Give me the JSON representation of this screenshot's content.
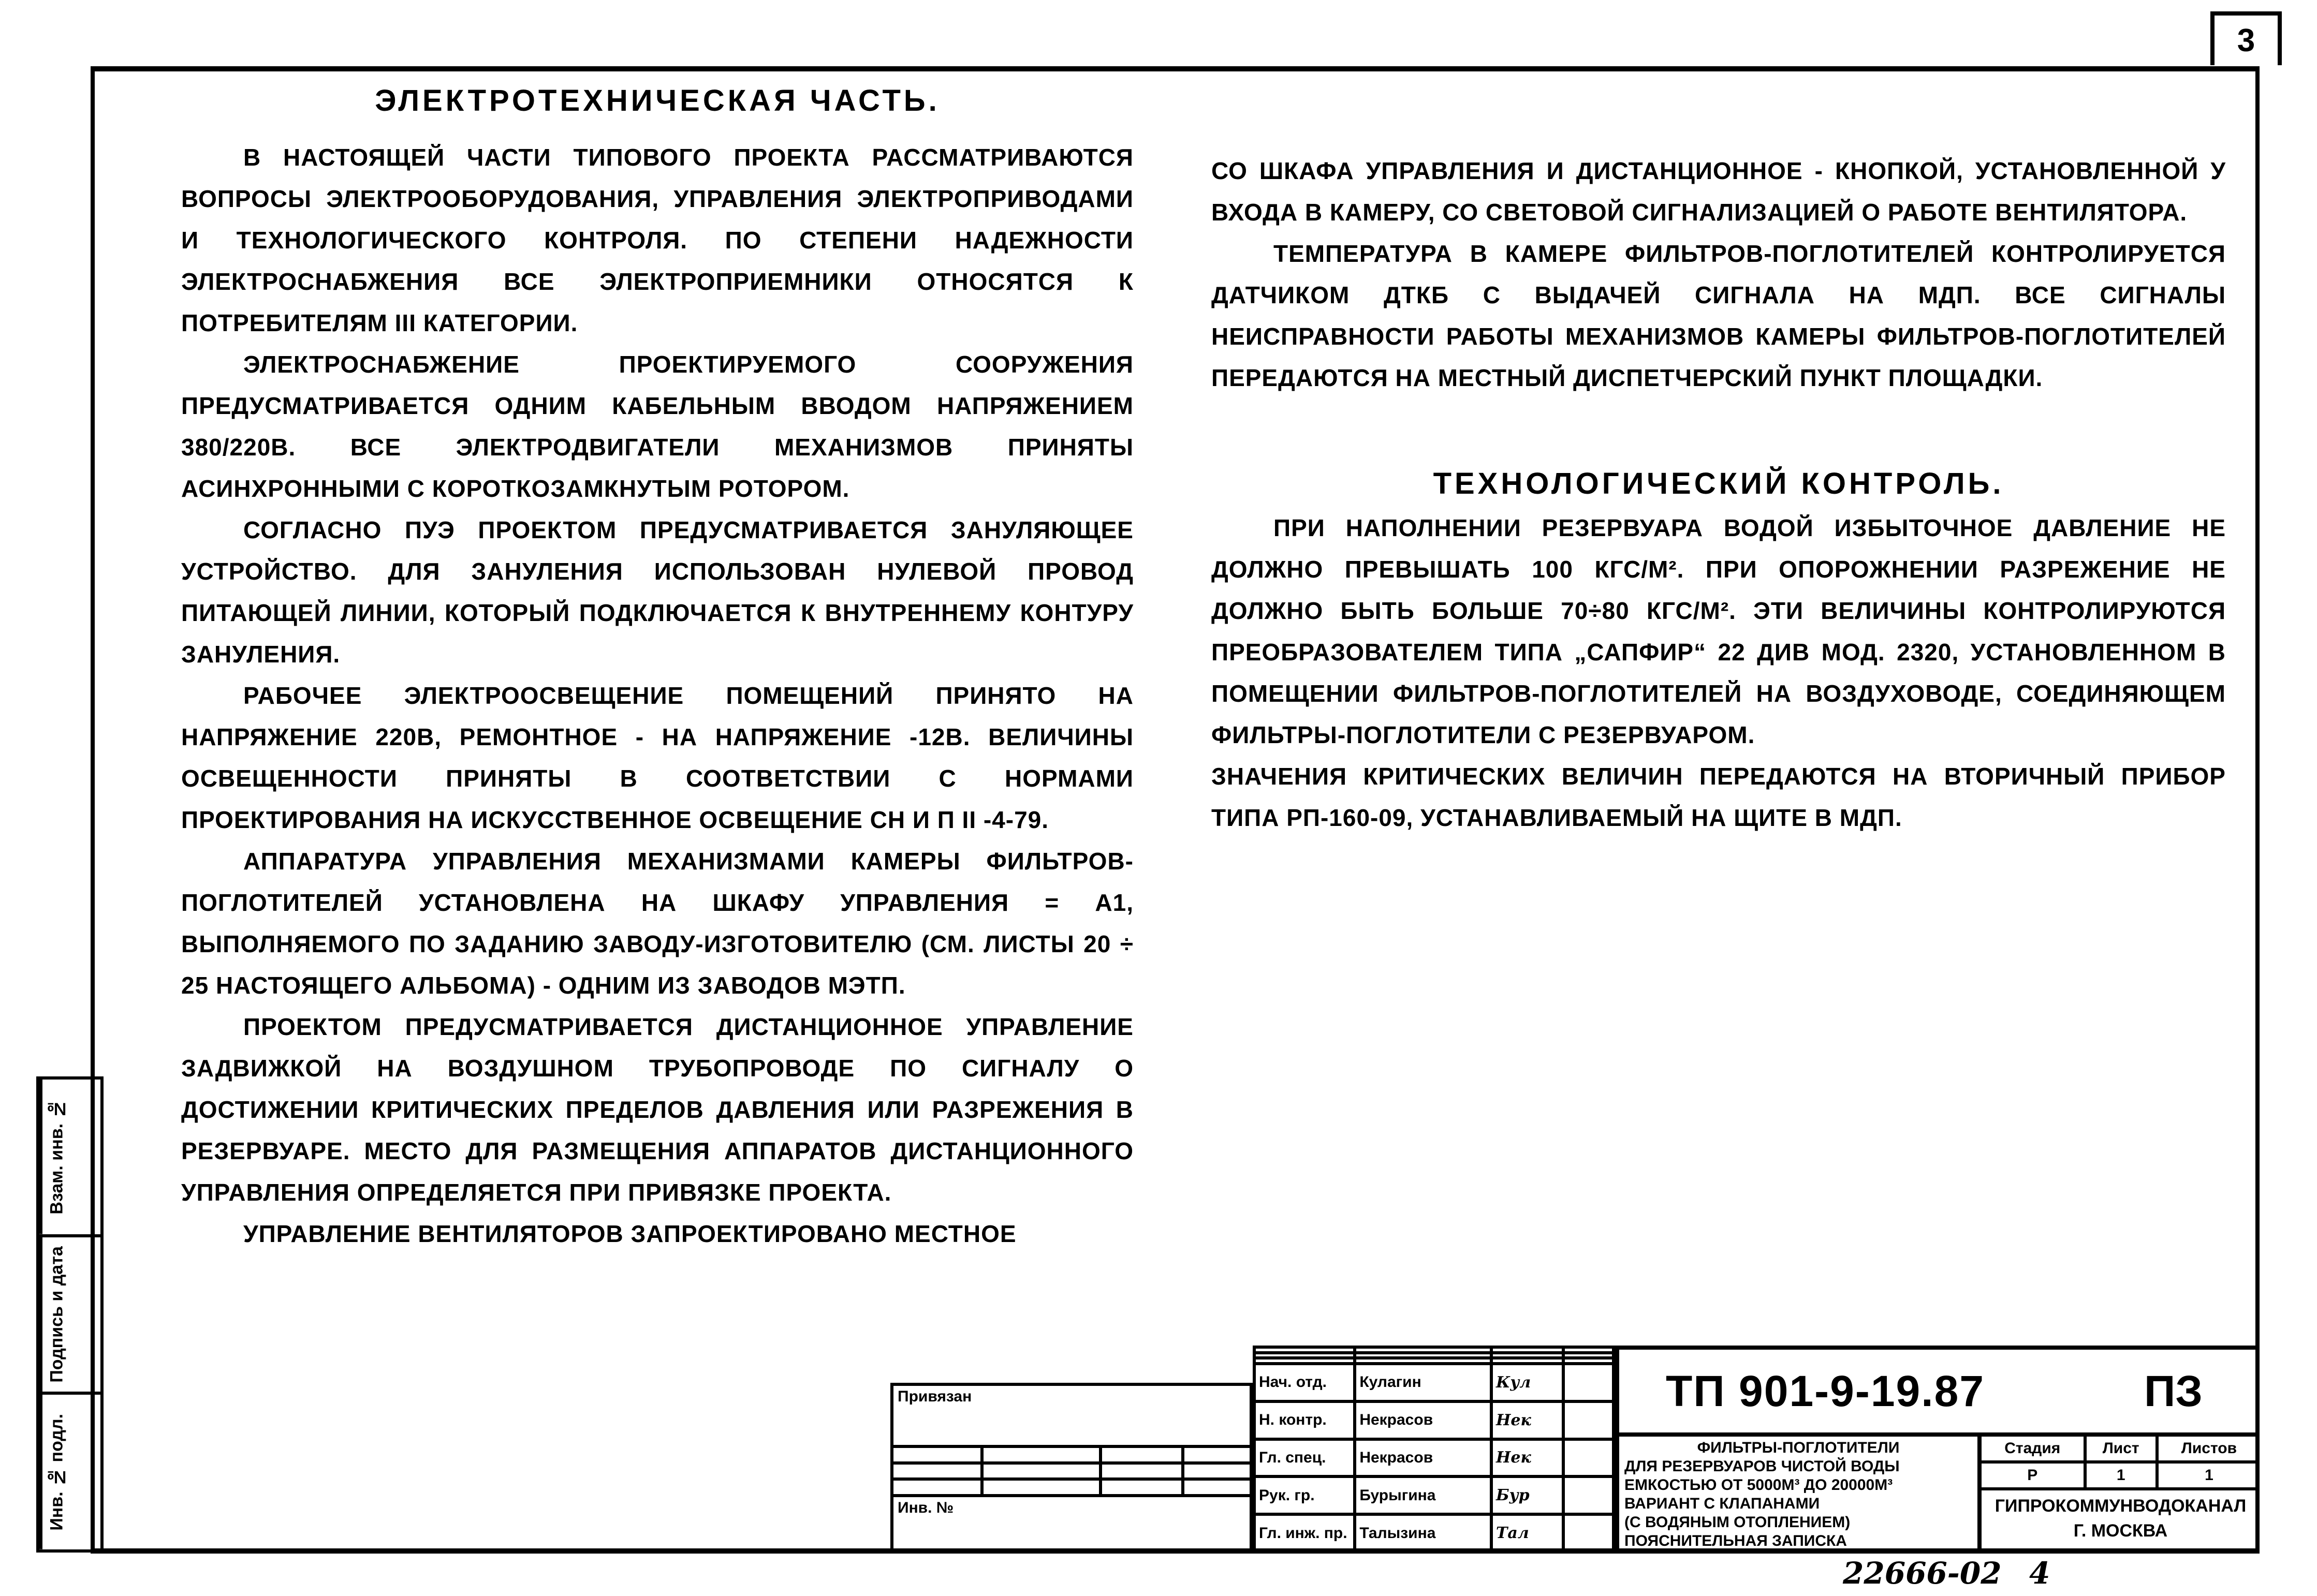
{
  "page_number": "3",
  "left_column": {
    "heading": "Электротехническая часть.",
    "paragraphs": [
      "В настоящей части типового проекта рассматриваются вопросы электрооборудования, управления электроприводами и технологического контроля. По степени надежности электроснабжения все электроприемники относятся к потребителям III категории.",
      "Электроснабжение проектируемого сооружения предусматривается одним кабельным вводом напряжением 380/220В. Все электродвигатели механизмов приняты асинхронными с короткозамкнутым ротором.",
      "Согласно ПУЭ проектом предусматривается зануляющее устройство. Для зануления использован нулевой провод питающей линии, который подключается к внутреннему контуру зануления.",
      "Рабочее электроосвещение помещений принято на напряжение 220В, ремонтное - на напряжение -12В. Величины освещенности приняты в соответствии с нормами проектирования на искусственное освещение СН и П II -4-79.",
      "Аппаратура управления механизмами камеры фильтров-поглотителей установлена на шкафу управления = А1, выполняемого по заданию заводу-изготовителю (см. листы 20 ÷ 25 настоящего альбома) - одним из заводов МЭТП.",
      "Проектом предусматривается дистанционное управление задвижкой на воздушном трубопроводе по сигналу о достижении критических пределов давления или разрежения в резервуаре. Место для размещения аппаратов дистанционного управления определяется при привязке проекта.",
      "Управление вентиляторов запроектировано местное"
    ]
  },
  "right_column": {
    "paragraphs_top": [
      "со шкафа управления и дистанционное - кнопкой, установленной у входа в камеру, со световой сигнализацией о работе вентилятора.",
      "Температура в камере фильтров-поглотителей контролируется датчиком ДТКБ с выдачей сигнала на МДП. Все сигналы неисправности работы механизмов камеры фильтров-поглотителей передаются на местный диспетчерский пункт площадки."
    ],
    "heading": "Технологический контроль.",
    "paragraphs_bottom": [
      "При наполнении резервуара водой избыточное давление не должно превышать 100 кгс/м². При опорожнении разрежение не должно быть больше 70÷80 кгс/м². Эти величины контролируются преобразователем типа „Сапфир“ 22 ДИВ мод. 2320, установленном в помещении фильтров-поглотителей на воздуховоде, соединяющем фильтры-поглотители с резервуаром.",
      "Значения критических величин передаются на вторичный прибор типа РП-160-09, устанавливаемый на щите в МДП."
    ]
  },
  "side_stamp": {
    "cells": [
      {
        "label": "Взам. инв. №"
      },
      {
        "label": "Подпись и дата"
      },
      {
        "label": "Инв. № подл."
      }
    ]
  },
  "title_block": {
    "privyazan_label": "Привязан",
    "inv_label": "Инв. №",
    "signers": [
      {
        "role": "Нач. отд.",
        "name": "Кулагин",
        "signature": "Кул"
      },
      {
        "role": "Н. контр.",
        "name": "Некрасов",
        "signature": "Нек"
      },
      {
        "role": "Гл. спец.",
        "name": "Некрасов",
        "signature": "Нек"
      },
      {
        "role": "Рук. гр.",
        "name": "Бурыгина",
        "signature": "Бур"
      },
      {
        "role": "Гл. инж. пр.",
        "name": "Талызина",
        "signature": "Тал"
      }
    ],
    "doc_code": "ТП 901-9-19.87",
    "doc_type": "ПЗ",
    "description_lines": [
      "Фильтры-поглотители",
      "для резервуаров чистой воды",
      "емкостью от 5000м³ до 20000м³",
      "вариант с клапанами",
      "(с водяным отоплением)",
      "Пояснительная записка"
    ],
    "stage_headers": [
      "Стадия",
      "Лист",
      "Листов"
    ],
    "stage_values": [
      "Р",
      "1",
      "1"
    ],
    "organization_lines": [
      "Гипрокоммунводоканал",
      "г. Москва"
    ]
  },
  "archive_number": "22666-02",
  "archive_sheet": "4"
}
